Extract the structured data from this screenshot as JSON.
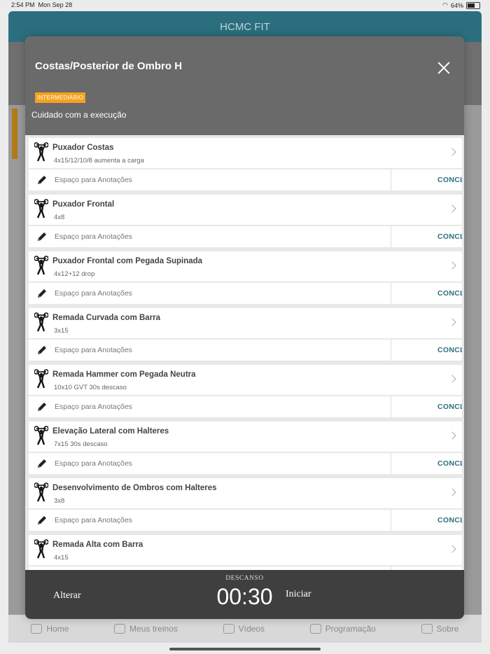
{
  "status": {
    "time": "2:54 PM",
    "date": "Mon Sep 28",
    "battery": "64%"
  },
  "app": {
    "title": "HCMC FIT"
  },
  "tabs": [
    {
      "label": "Home",
      "icon": "home-icon"
    },
    {
      "label": "Meus treinos",
      "icon": "dumbbell-icon"
    },
    {
      "label": "Vídeos",
      "icon": "video-icon"
    },
    {
      "label": "Programação",
      "icon": "calendar-icon"
    },
    {
      "label": "Sobre",
      "icon": "info-icon"
    }
  ],
  "modal": {
    "title": "Costas/Posterior de Ombro H",
    "level": "INTERMEDIÁRIO",
    "note": "Cuidado com a execução",
    "note_placeholder": "Espaço para Anotações",
    "complete_label": "CONCL",
    "exercises": [
      {
        "name": "Puxador Costas",
        "detail": "4x15/12/10/8 aumenta a carga"
      },
      {
        "name": "Puxador Frontal",
        "detail": "4x8"
      },
      {
        "name": "Puxador Frontal com Pegada Supinada",
        "detail": "4x12+12 drop"
      },
      {
        "name": "Remada Curvada com Barra",
        "detail": "3x15"
      },
      {
        "name": "Remada Hammer com Pegada Neutra",
        "detail": "10x10 GVT 30s descaso"
      },
      {
        "name": "Elevação Lateral com Halteres",
        "detail": "7x15 30s descaso"
      },
      {
        "name": "Desenvolvimento de Ombros com Halteres",
        "detail": "3x8"
      },
      {
        "name": "Remada Alta com Barra",
        "detail": "4x15"
      }
    ],
    "footer": {
      "alter_label": "Alterar",
      "rest_label": "DESCANSO",
      "timer": "00:30",
      "start_label": "Iniciar"
    }
  }
}
